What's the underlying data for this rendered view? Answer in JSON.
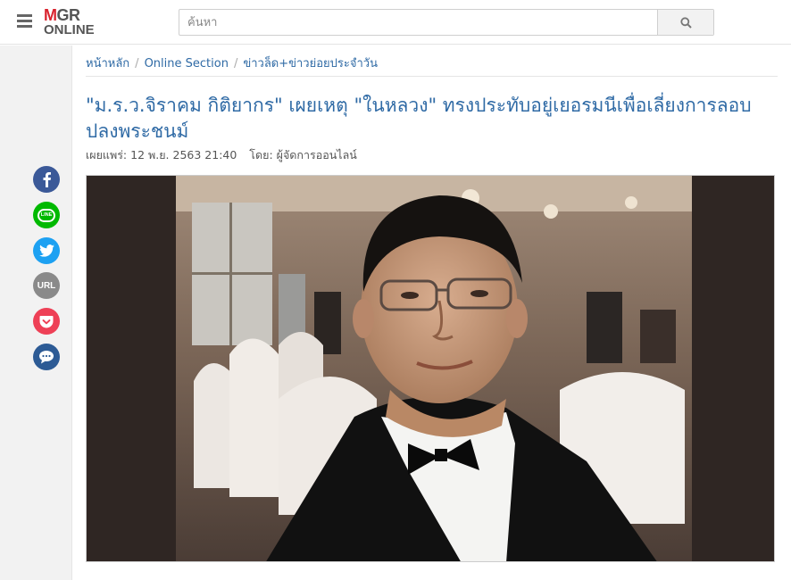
{
  "header": {
    "logo_top_m": "M",
    "logo_top_gr": "GR",
    "logo_bottom": "ONLINE",
    "search_placeholder": "ค้นหา"
  },
  "breadcrumb": {
    "items": [
      {
        "label": "หน้าหลัก"
      },
      {
        "label": "Online Section"
      },
      {
        "label": "ข่าวล็ด+ข่าวย่อยประจำวัน"
      }
    ],
    "separator": "/"
  },
  "article": {
    "title": "\"ม.ร.ว.จิราคม กิติยากร\" เผยเหตุ \"ในหลวง\" ทรงประทับอยู่เยอรมนีเพื่อเลี่ยงการลอบปลงพระชนม์",
    "published_label": "เผยแพร่:",
    "published_date": "12 พ.ย. 2563 21:40",
    "by_label": "โดย:",
    "author": "ผู้จัดการออนไลน์"
  },
  "share": {
    "line_label": "LINE",
    "url_label": "URL"
  },
  "colors": {
    "link": "#2f6aa5",
    "brand_red": "#d9232e",
    "facebook": "#3b5998",
    "line": "#00b900",
    "twitter": "#1da1f2",
    "pocket": "#ee4056"
  }
}
